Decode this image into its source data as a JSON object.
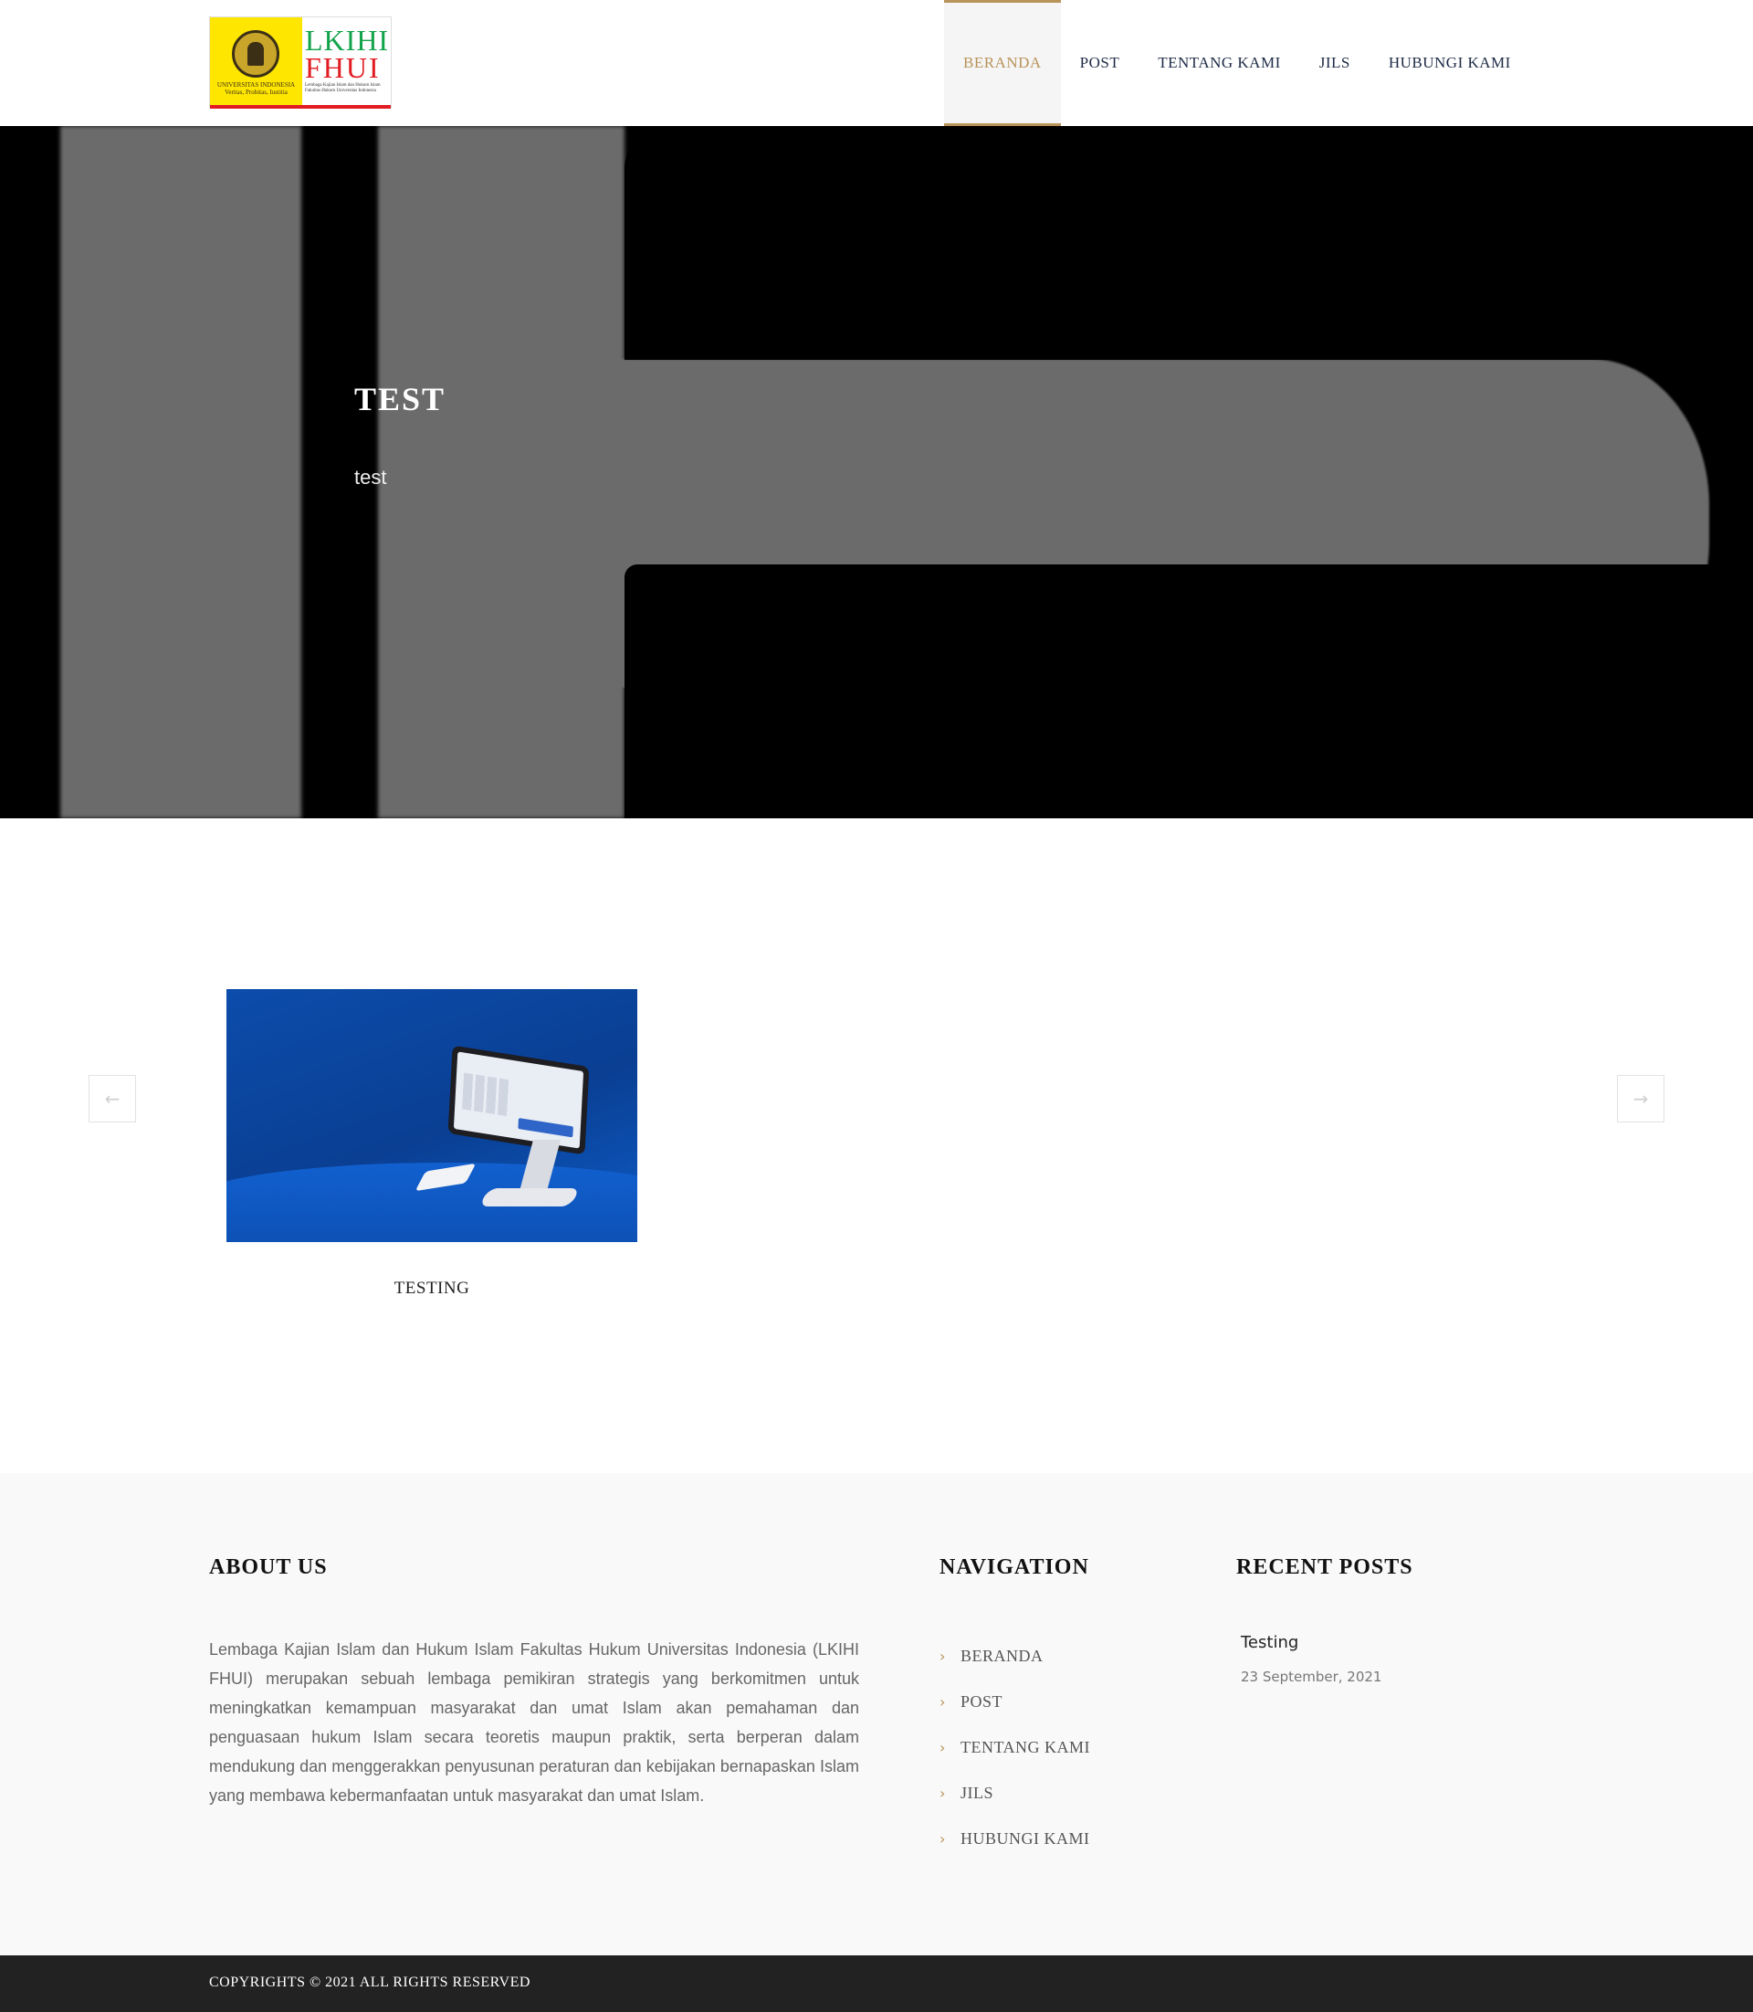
{
  "header": {
    "logo": {
      "left_text": "UNIVERSITAS INDONESIA",
      "left_motto": "Veritas, Probitas, Iustitia",
      "line1": "LKIHI",
      "line2": "FHUI",
      "tagline": "Lembaga Kajian Islam dan Hukum Islam Fakultas Hukum Universitas Indonesia"
    },
    "nav": [
      {
        "label": "BERANDA",
        "active": true
      },
      {
        "label": "POST",
        "active": false
      },
      {
        "label": "TENTANG KAMI",
        "active": false
      },
      {
        "label": "JILS",
        "active": false
      },
      {
        "label": "HUBUNGI KAMI",
        "active": false
      }
    ]
  },
  "hero": {
    "title": "TEST",
    "subtitle": "test"
  },
  "carousel": {
    "prev_icon": "arrow-left-icon",
    "next_icon": "arrow-right-icon",
    "items": [
      {
        "title": "TESTING",
        "image": "pos-tablet-image"
      }
    ]
  },
  "footer": {
    "about": {
      "heading": "ABOUT US",
      "text": "Lembaga Kajian Islam dan Hukum Islam Fakultas Hukum Universitas Indonesia (LKIHI FHUI) merupakan sebuah lembaga pemikiran strategis yang berkomitmen untuk meningkatkan kemampuan masyarakat dan umat Islam akan pemahaman dan penguasaan hukum Islam secara teoretis maupun praktik, serta berperan dalam mendukung dan menggerakkan penyusunan peraturan dan kebijakan bernapaskan Islam yang membawa kebermanfaatan untuk masyarakat dan umat Islam."
    },
    "navigation": {
      "heading": "NAVIGATION",
      "items": [
        "BERANDA",
        "POST",
        "TENTANG KAMI",
        "JILS",
        "HUBUNGI KAMI"
      ]
    },
    "recent": {
      "heading": "RECENT POSTS",
      "posts": [
        {
          "title": "Testing",
          "date": "23 September, 2021"
        }
      ]
    },
    "copyright": "COPYRIGHTS © 2021 ALL RIGHTS RESERVED"
  },
  "colors": {
    "accent": "#b8935a",
    "nav_text": "#1c2a45",
    "footer_bg": "#f9f9f9",
    "bottom_bar": "#222222"
  }
}
